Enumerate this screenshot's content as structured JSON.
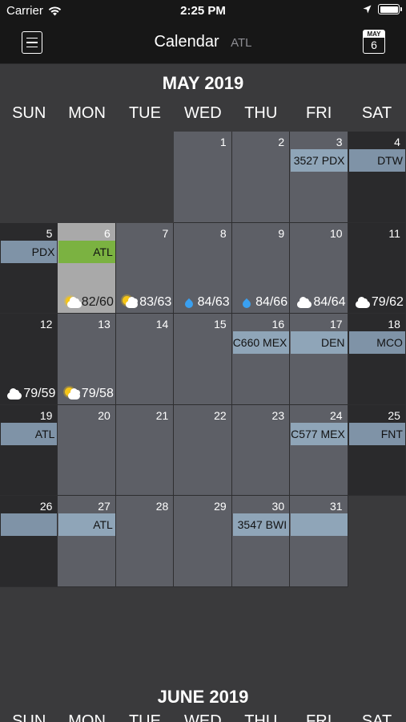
{
  "status_bar": {
    "carrier": "Carrier",
    "time": "2:25 PM"
  },
  "nav": {
    "title": "Calendar",
    "subtitle": "ATL",
    "cal_icon_month": "MAY",
    "cal_icon_day": "6"
  },
  "month": {
    "title": "MAY 2019",
    "days_of_week": [
      "SUN",
      "MON",
      "TUE",
      "WED",
      "THU",
      "FRI",
      "SAT"
    ],
    "weeks": [
      [
        {
          "day": "",
          "empty": true
        },
        {
          "day": "",
          "empty": true
        },
        {
          "day": "",
          "empty": true
        },
        {
          "day": "1"
        },
        {
          "day": "2"
        },
        {
          "day": "3",
          "event": "3527 PDX"
        },
        {
          "day": "4",
          "event": "DTW"
        }
      ],
      [
        {
          "day": "5",
          "event": "PDX"
        },
        {
          "day": "6",
          "event": "ATL",
          "today": true,
          "weather_icon": "partly-cloudy-icon",
          "weather": "82/60"
        },
        {
          "day": "7",
          "weather_icon": "sun-cloud-icon",
          "weather": "83/63"
        },
        {
          "day": "8",
          "weather_icon": "rain-drop-icon",
          "weather": "84/63"
        },
        {
          "day": "9",
          "weather_icon": "rain-drop-icon",
          "weather": "84/66"
        },
        {
          "day": "10",
          "weather_icon": "cloud-icon",
          "weather": "84/64"
        },
        {
          "day": "11",
          "weather_icon": "cloud-icon",
          "weather": "79/62"
        }
      ],
      [
        {
          "day": "12",
          "weather_icon": "cloud-icon",
          "weather": "79/59"
        },
        {
          "day": "13",
          "weather_icon": "sun-cloud-icon",
          "weather": "79/58"
        },
        {
          "day": "14"
        },
        {
          "day": "15"
        },
        {
          "day": "16",
          "event": "C660 MEX"
        },
        {
          "day": "17",
          "event": "DEN"
        },
        {
          "day": "18",
          "event": "MCO"
        }
      ],
      [
        {
          "day": "19",
          "event": "ATL"
        },
        {
          "day": "20"
        },
        {
          "day": "21"
        },
        {
          "day": "22"
        },
        {
          "day": "23"
        },
        {
          "day": "24",
          "event": "C577 MEX"
        },
        {
          "day": "25",
          "event": "FNT"
        }
      ],
      [
        {
          "day": "26",
          "event": ""
        },
        {
          "day": "27",
          "event": "ATL"
        },
        {
          "day": "28"
        },
        {
          "day": "29"
        },
        {
          "day": "30",
          "event": "3547 BWI"
        },
        {
          "day": "31",
          "event": ""
        },
        {
          "day": "",
          "empty": true
        }
      ]
    ]
  },
  "next_month": {
    "title": "JUNE 2019",
    "days_of_week": [
      "SUN",
      "MON",
      "TUE",
      "WED",
      "THU",
      "FRI",
      "SAT"
    ]
  },
  "colors": {
    "background": "#3a3a3c",
    "weekday_cell": "#5d5f66",
    "weekend_cell": "#2a2a2c",
    "today_cell": "#a9a9a9",
    "event_bar": "#8fa5b8",
    "today_event_bar": "#7bb241"
  }
}
